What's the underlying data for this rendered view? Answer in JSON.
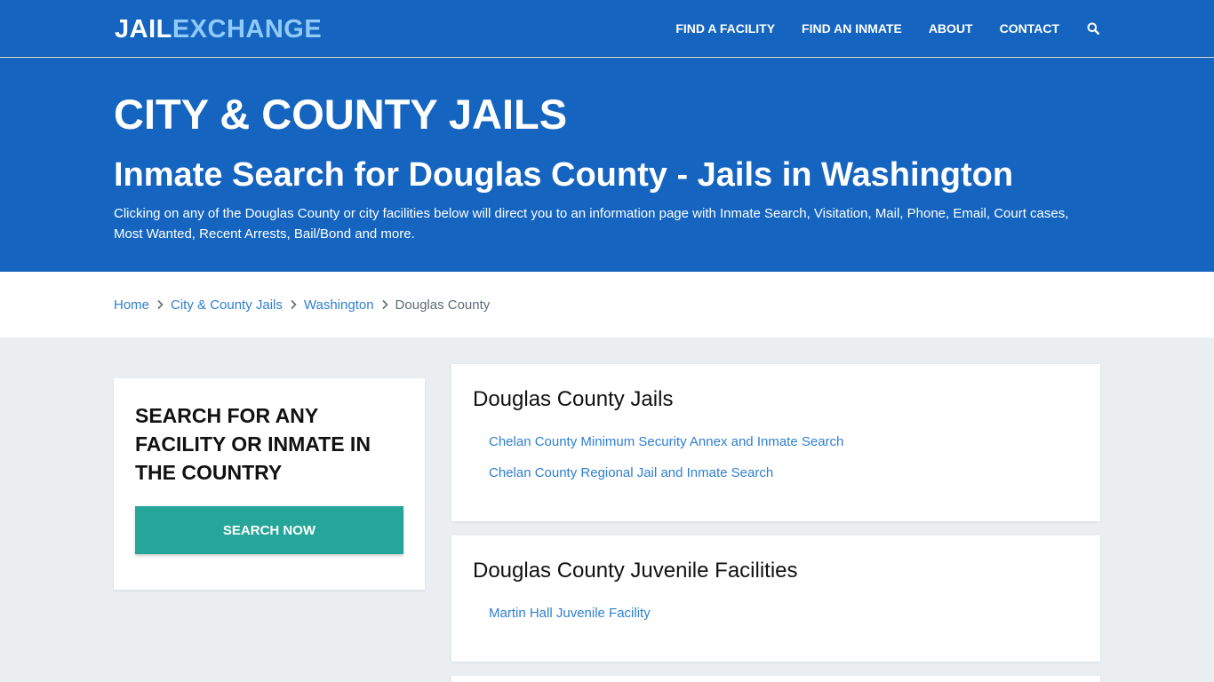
{
  "header": {
    "logo_part1": "JAIL",
    "logo_part2": "EXCHANGE",
    "nav": [
      {
        "label": "FIND A FACILITY"
      },
      {
        "label": "FIND AN INMATE"
      },
      {
        "label": "ABOUT"
      },
      {
        "label": "CONTACT"
      }
    ],
    "search_icon": "search-icon"
  },
  "hero": {
    "kicker": "CITY & COUNTY JAILS",
    "title": "Inmate Search for Douglas County - Jails in Washington",
    "description": "Clicking on any of the Douglas County or city facilities below will direct you to an information page with Inmate Search, Visitation, Mail, Phone, Email, Court cases, Most Wanted, Recent Arrests, Bail/Bond and more."
  },
  "breadcrumb": {
    "items": [
      {
        "label": "Home"
      },
      {
        "label": "City & County Jails"
      },
      {
        "label": "Washington"
      },
      {
        "label": "Douglas County"
      }
    ],
    "separator_icon": "chevron-right-icon"
  },
  "sidebar": {
    "title": "SEARCH FOR ANY FACILITY OR INMATE IN THE COUNTRY",
    "button_label": "SEARCH NOW"
  },
  "sections": [
    {
      "heading": "Douglas County Jails",
      "links": [
        {
          "label": "Chelan County Minimum Security Annex and Inmate Search"
        },
        {
          "label": "Chelan County Regional Jail and Inmate Search"
        }
      ]
    },
    {
      "heading": "Douglas County Juvenile Facilities",
      "links": [
        {
          "label": "Martin Hall Juvenile Facility"
        }
      ]
    }
  ],
  "colors": {
    "brand_blue": "#1565c0",
    "logo_accent": "#90caf9",
    "link_blue": "#2f7fd1",
    "button_teal": "#26a69a",
    "page_bg": "#eaeef1"
  }
}
